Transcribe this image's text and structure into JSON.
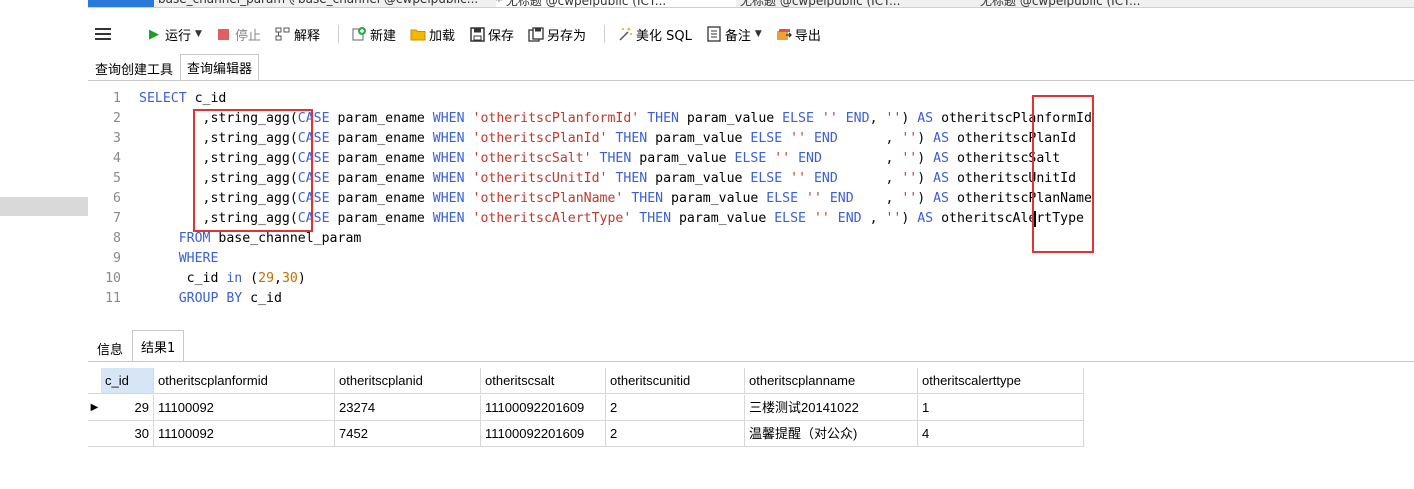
{
  "tabs": [
    {
      "label": "对象"
    },
    {
      "label": "base_channel_param @cwp..."
    },
    {
      "label": "base_channel @cwpeipublic..."
    },
    {
      "label": "* 无标题 @cwpeipublic (ICT..."
    },
    {
      "label": "无标题 @cwpeipublic (ICT..."
    },
    {
      "label": "无标题 @cwpeipublic (ICT..."
    }
  ],
  "toolbar": {
    "run_label": "运行",
    "stop_label": "停止",
    "explain_label": "解释",
    "new_label": "新建",
    "load_label": "加载",
    "save_label": "保存",
    "saveas_label": "另存为",
    "beautify_label": "美化 SQL",
    "comment_label": "备注",
    "export_label": "导出"
  },
  "subtabs": {
    "builder": "查询创建工具",
    "editor": "查询编辑器"
  },
  "code": {
    "lines": [
      {
        "n": "1",
        "parts": [
          [
            "kw",
            "SELECT"
          ],
          [
            "txt",
            " c_id"
          ]
        ]
      },
      {
        "n": "2",
        "parts": [
          [
            "txt",
            "        ,string_agg("
          ],
          [
            "kw",
            "CASE"
          ],
          [
            "txt",
            " param_ename "
          ],
          [
            "kw",
            "WHEN"
          ],
          [
            "txt",
            " "
          ],
          [
            "str",
            "'otheritscPlanformId'"
          ],
          [
            "txt",
            " "
          ],
          [
            "kw",
            "THEN"
          ],
          [
            "txt",
            " param_value "
          ],
          [
            "kw",
            "ELSE"
          ],
          [
            "txt",
            " "
          ],
          [
            "str",
            "''"
          ],
          [
            "txt",
            " "
          ],
          [
            "kw",
            "END"
          ],
          [
            "txt",
            ", "
          ],
          [
            "str",
            "''"
          ],
          [
            "txt",
            ") "
          ],
          [
            "kw",
            "AS"
          ],
          [
            "txt",
            " otheritscPlanformId"
          ]
        ]
      },
      {
        "n": "3",
        "parts": [
          [
            "txt",
            "        ,string_agg("
          ],
          [
            "kw",
            "CASE"
          ],
          [
            "txt",
            " param_ename "
          ],
          [
            "kw",
            "WHEN"
          ],
          [
            "txt",
            " "
          ],
          [
            "str",
            "'otheritscPlanId'"
          ],
          [
            "txt",
            " "
          ],
          [
            "kw",
            "THEN"
          ],
          [
            "txt",
            " param_value "
          ],
          [
            "kw",
            "ELSE"
          ],
          [
            "txt",
            " "
          ],
          [
            "str",
            "''"
          ],
          [
            "txt",
            " "
          ],
          [
            "kw",
            "END"
          ],
          [
            "txt",
            "      , "
          ],
          [
            "str",
            "''"
          ],
          [
            "txt",
            ") "
          ],
          [
            "kw",
            "AS"
          ],
          [
            "txt",
            " otheritscPlanId"
          ]
        ]
      },
      {
        "n": "4",
        "parts": [
          [
            "txt",
            "        ,string_agg("
          ],
          [
            "kw",
            "CASE"
          ],
          [
            "txt",
            " param_ename "
          ],
          [
            "kw",
            "WHEN"
          ],
          [
            "txt",
            " "
          ],
          [
            "str",
            "'otheritscSalt'"
          ],
          [
            "txt",
            " "
          ],
          [
            "kw",
            "THEN"
          ],
          [
            "txt",
            " param_value "
          ],
          [
            "kw",
            "ELSE"
          ],
          [
            "txt",
            " "
          ],
          [
            "str",
            "''"
          ],
          [
            "txt",
            " "
          ],
          [
            "kw",
            "END"
          ],
          [
            "txt",
            "        , "
          ],
          [
            "str",
            "''"
          ],
          [
            "txt",
            ") "
          ],
          [
            "kw",
            "AS"
          ],
          [
            "txt",
            " otheritscSalt"
          ]
        ]
      },
      {
        "n": "5",
        "parts": [
          [
            "txt",
            "        ,string_agg("
          ],
          [
            "kw",
            "CASE"
          ],
          [
            "txt",
            " param_ename "
          ],
          [
            "kw",
            "WHEN"
          ],
          [
            "txt",
            " "
          ],
          [
            "str",
            "'otheritscUnitId'"
          ],
          [
            "txt",
            " "
          ],
          [
            "kw",
            "THEN"
          ],
          [
            "txt",
            " param_value "
          ],
          [
            "kw",
            "ELSE"
          ],
          [
            "txt",
            " "
          ],
          [
            "str",
            "''"
          ],
          [
            "txt",
            " "
          ],
          [
            "kw",
            "END"
          ],
          [
            "txt",
            "      , "
          ],
          [
            "str",
            "''"
          ],
          [
            "txt",
            ") "
          ],
          [
            "kw",
            "AS"
          ],
          [
            "txt",
            " otheritscUnitId"
          ]
        ]
      },
      {
        "n": "6",
        "parts": [
          [
            "txt",
            "        ,string_agg("
          ],
          [
            "kw",
            "CASE"
          ],
          [
            "txt",
            " param_ename "
          ],
          [
            "kw",
            "WHEN"
          ],
          [
            "txt",
            " "
          ],
          [
            "str",
            "'otheritscPlanName'"
          ],
          [
            "txt",
            " "
          ],
          [
            "kw",
            "THEN"
          ],
          [
            "txt",
            " param_value "
          ],
          [
            "kw",
            "ELSE"
          ],
          [
            "txt",
            " "
          ],
          [
            "str",
            "''"
          ],
          [
            "txt",
            " "
          ],
          [
            "kw",
            "END"
          ],
          [
            "txt",
            "    , "
          ],
          [
            "str",
            "''"
          ],
          [
            "txt",
            ") "
          ],
          [
            "kw",
            "AS"
          ],
          [
            "txt",
            " otheritscPlanName"
          ]
        ]
      },
      {
        "n": "7",
        "parts": [
          [
            "txt",
            "        ,string_agg("
          ],
          [
            "kw",
            "CASE"
          ],
          [
            "txt",
            " param_ename "
          ],
          [
            "kw",
            "WHEN"
          ],
          [
            "txt",
            " "
          ],
          [
            "str",
            "'otheritscAlertType'"
          ],
          [
            "txt",
            " "
          ],
          [
            "kw",
            "THEN"
          ],
          [
            "txt",
            " param_value "
          ],
          [
            "kw",
            "ELSE"
          ],
          [
            "txt",
            " "
          ],
          [
            "str",
            "''"
          ],
          [
            "txt",
            " "
          ],
          [
            "kw",
            "END"
          ],
          [
            "txt",
            " , "
          ],
          [
            "str",
            "''"
          ],
          [
            "txt",
            ") "
          ],
          [
            "kw",
            "AS"
          ],
          [
            "txt",
            " otheritscAlertType"
          ]
        ]
      },
      {
        "n": "8",
        "parts": [
          [
            "txt",
            "     "
          ],
          [
            "kw",
            "FROM"
          ],
          [
            "txt",
            " base_channel_param"
          ]
        ]
      },
      {
        "n": "9",
        "parts": [
          [
            "txt",
            "     "
          ],
          [
            "kw",
            "WHERE"
          ]
        ]
      },
      {
        "n": "10",
        "parts": [
          [
            "txt",
            "      c_id "
          ],
          [
            "kw",
            "in"
          ],
          [
            "txt",
            " ("
          ],
          [
            "num",
            "29"
          ],
          [
            "txt",
            ","
          ],
          [
            "num",
            "30"
          ],
          [
            "txt",
            ")"
          ]
        ]
      },
      {
        "n": "11",
        "parts": [
          [
            "txt",
            "     "
          ],
          [
            "kw",
            "GROUP BY"
          ],
          [
            "txt",
            " c_id"
          ]
        ]
      }
    ]
  },
  "result_tabs": {
    "info": "信息",
    "result1": "结果1"
  },
  "grid": {
    "columns": [
      "c_id",
      "otheritscplanformid",
      "otheritscplanid",
      "otheritscsalt",
      "otheritscunitid",
      "otheritscplanname",
      "otheritscalerttype"
    ],
    "rows": [
      [
        "29",
        "11100092",
        "23274",
        "11100092201609",
        "2",
        "三楼测试20141022",
        "1"
      ],
      [
        "30",
        "11100092",
        "7452",
        "11100092201609",
        "2",
        "温馨提醒（对公众)",
        "4"
      ]
    ]
  }
}
